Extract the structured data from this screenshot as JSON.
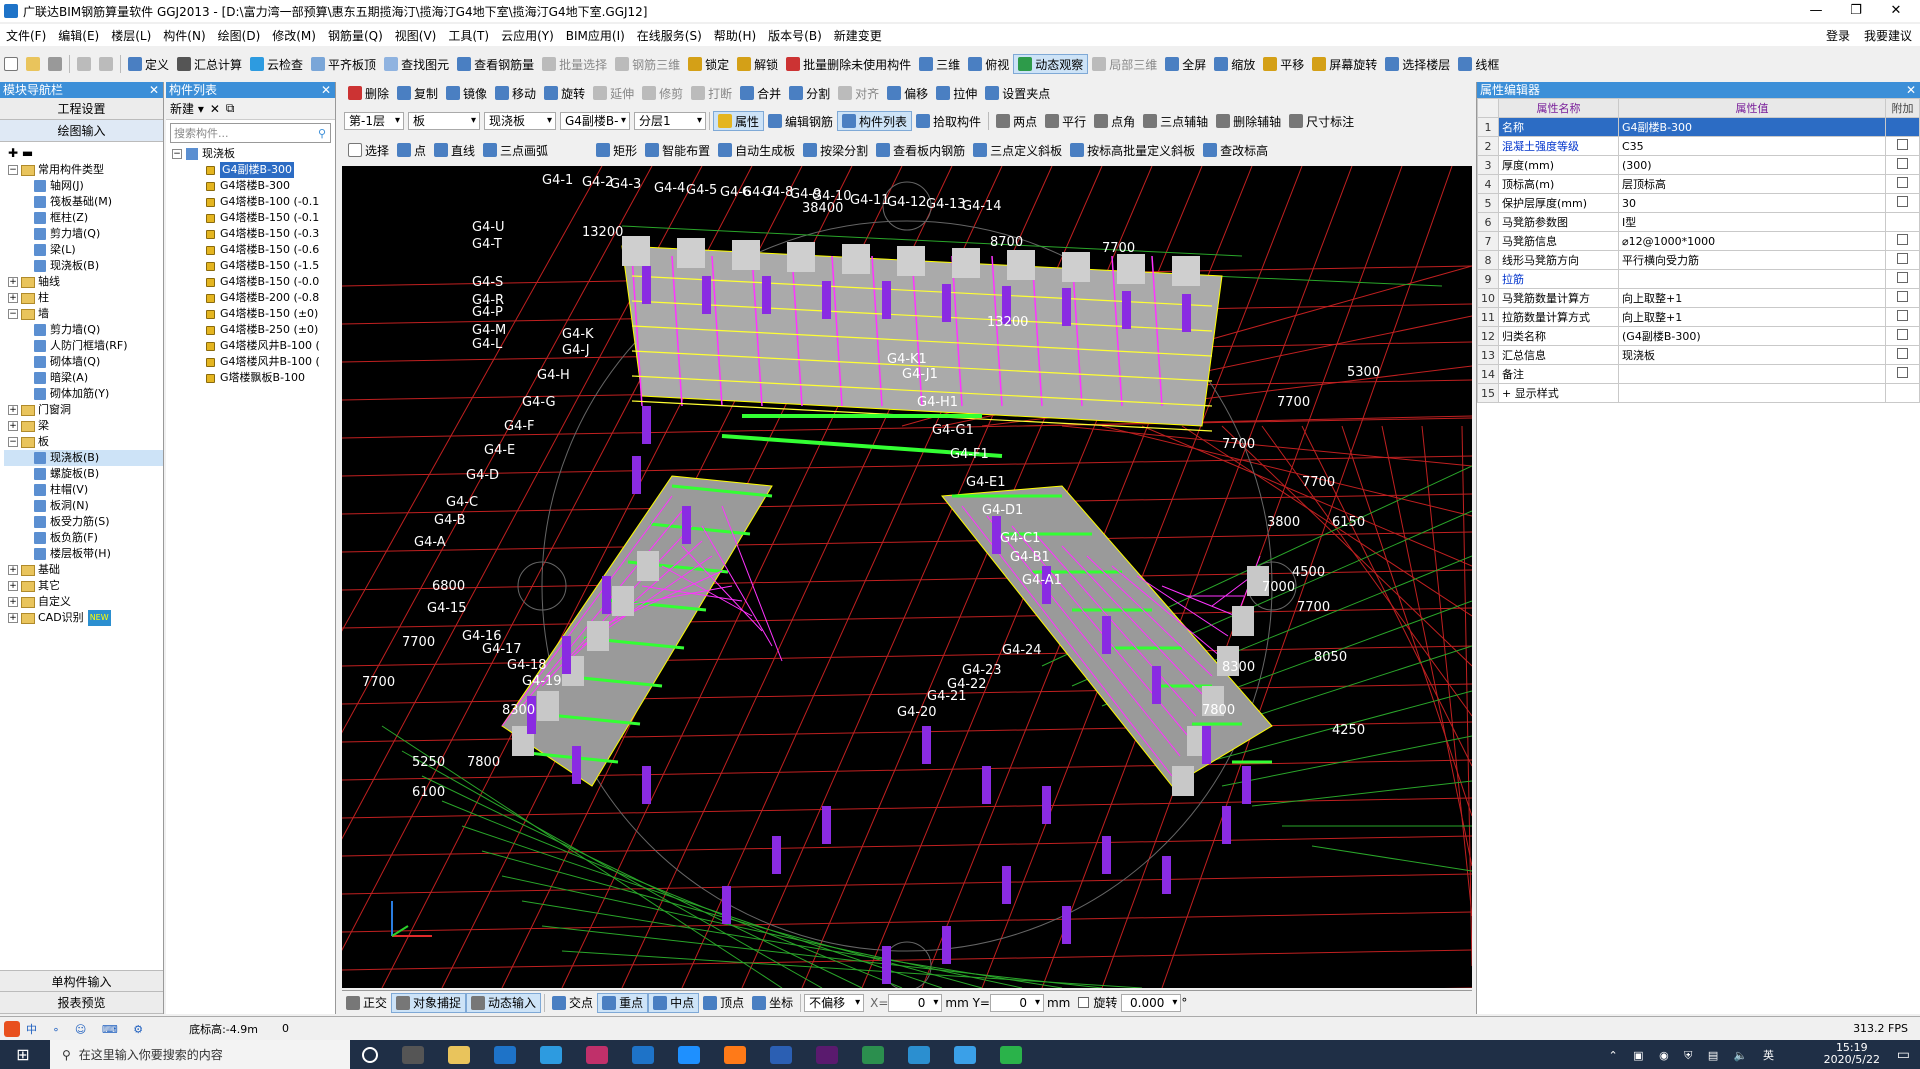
{
  "window": {
    "title": "广联达BIM钢筋算量软件 GGJ2013 - [D:\\富力湾一部预算\\惠东五期揽海汀\\揽海汀G4地下室\\揽海汀G4地下室.GGJ12]",
    "controls": [
      "—",
      "❐",
      "✕"
    ]
  },
  "menu": {
    "items": [
      "文件(F)",
      "编辑(E)",
      "楼层(L)",
      "构件(N)",
      "绘图(D)",
      "修改(M)",
      "钢筋量(Q)",
      "视图(V)",
      "工具(T)",
      "云应用(Y)",
      "BIM应用(I)",
      "在线服务(S)",
      "帮助(H)",
      "版本号(B)",
      "新建变更"
    ],
    "login": "登录",
    "feedback": "我要建议"
  },
  "toolbar1": [
    "定义",
    "汇总计算",
    "云检查",
    "平齐板顶",
    "查找图元",
    "查看钢筋量",
    "批量选择",
    "钢筋三维",
    "锁定",
    "解锁",
    "批量删除未使用构件",
    "三维",
    "俯视",
    "动态观察",
    "局部三维",
    "全屏",
    "缩放",
    "平移",
    "屏幕旋转",
    "选择楼层",
    "线框"
  ],
  "leftnav": {
    "header": "模块导航栏",
    "btn1": "工程设置",
    "btn2": "绘图输入",
    "bottom1": "单构件输入",
    "bottom2": "报表预览",
    "tree": [
      {
        "lvl": 0,
        "exp": "-",
        "label": "常用构件类型",
        "fold": true
      },
      {
        "lvl": 1,
        "label": "轴网(J)"
      },
      {
        "lvl": 1,
        "label": "筏板基础(M)"
      },
      {
        "lvl": 1,
        "label": "框柱(Z)"
      },
      {
        "lvl": 1,
        "label": "剪力墙(Q)"
      },
      {
        "lvl": 1,
        "label": "梁(L)"
      },
      {
        "lvl": 1,
        "label": "现浇板(B)"
      },
      {
        "lvl": 0,
        "exp": "+",
        "label": "轴线",
        "fold": true
      },
      {
        "lvl": 0,
        "exp": "+",
        "label": "柱",
        "fold": true
      },
      {
        "lvl": 0,
        "exp": "-",
        "label": "墙",
        "fold": true
      },
      {
        "lvl": 1,
        "label": "剪力墙(Q)"
      },
      {
        "lvl": 1,
        "label": "人防门框墙(RF)"
      },
      {
        "lvl": 1,
        "label": "砌体墙(Q)"
      },
      {
        "lvl": 1,
        "label": "暗梁(A)"
      },
      {
        "lvl": 1,
        "label": "砌体加筋(Y)"
      },
      {
        "lvl": 0,
        "exp": "+",
        "label": "门窗洞",
        "fold": true
      },
      {
        "lvl": 0,
        "exp": "+",
        "label": "梁",
        "fold": true
      },
      {
        "lvl": 0,
        "exp": "-",
        "label": "板",
        "fold": true
      },
      {
        "lvl": 1,
        "label": "现浇板(B)",
        "sel": true
      },
      {
        "lvl": 1,
        "label": "螺旋板(B)"
      },
      {
        "lvl": 1,
        "label": "柱帽(V)"
      },
      {
        "lvl": 1,
        "label": "板洞(N)"
      },
      {
        "lvl": 1,
        "label": "板受力筋(S)"
      },
      {
        "lvl": 1,
        "label": "板负筋(F)"
      },
      {
        "lvl": 1,
        "label": "楼层板带(H)"
      },
      {
        "lvl": 0,
        "exp": "+",
        "label": "基础",
        "fold": true
      },
      {
        "lvl": 0,
        "exp": "+",
        "label": "其它",
        "fold": true
      },
      {
        "lvl": 0,
        "exp": "+",
        "label": "自定义",
        "fold": true
      },
      {
        "lvl": 0,
        "exp": "+",
        "label": "CAD识别",
        "fold": true,
        "badge": "NEW"
      }
    ]
  },
  "complist": {
    "header": "构件列表",
    "new": "新建",
    "search_placeholder": "搜索构件...",
    "root": "现浇板",
    "items": [
      "G4副楼B-300",
      "G4塔楼B-300",
      "G4塔楼B-100 (-0.1",
      "G4塔楼B-150 (-0.1",
      "G4塔楼B-150 (-0.3",
      "G4塔楼B-150 (-0.6",
      "G4塔楼B-150 (-1.5",
      "G4塔楼B-150 (-0.0",
      "G4塔楼B-200 (-0.8",
      "G4塔楼B-150 (±0)",
      "G4塔楼B-250 (±0)",
      "G4塔楼风井B-100 (",
      "G4塔楼风井B-100 (",
      "G塔楼飘板B-100"
    ]
  },
  "toolbar2": [
    "删除",
    "复制",
    "镜像",
    "移动",
    "旋转",
    "延伸",
    "修剪",
    "打断",
    "合并",
    "分割",
    "对齐",
    "偏移",
    "拉伸",
    "设置夹点"
  ],
  "toolbar3": {
    "floor": "第-1层",
    "type": "板",
    "sub": "现浇板",
    "comp": "G4副楼B-",
    "layer": "分层1",
    "btns": [
      "属性",
      "编辑钢筋",
      "构件列表",
      "拾取构件",
      "两点",
      "平行",
      "点角",
      "三点辅轴",
      "删除辅轴",
      "尺寸标注"
    ]
  },
  "toolbar4": [
    "选择",
    "点",
    "直线",
    "三点画弧",
    "矩形",
    "智能布置",
    "自动生成板",
    "按梁分割",
    "查看板内钢筋",
    "三点定义斜板",
    "按标高批量定义斜板",
    "查改标高"
  ],
  "snapbar": {
    "btns": [
      "正交",
      "对象捕捉",
      "动态输入",
      "交点",
      "重点",
      "中点",
      "顶点",
      "坐标"
    ],
    "offset": "不偏移",
    "x_label": "X=",
    "x_val": "0",
    "y_label": "mm Y=",
    "y_val": "0",
    "unit": "mm",
    "rotate": "旋转",
    "rot_val": "0.000",
    "deg": "°"
  },
  "props": {
    "header": "属性编辑器",
    "cols": [
      "属性名称",
      "属性值",
      "附加"
    ],
    "rows": [
      {
        "n": "1",
        "name": "名称",
        "val": "G4副楼B-300",
        "blue": true,
        "hl": true,
        "cb": false
      },
      {
        "n": "2",
        "name": "混凝土强度等级",
        "val": "C35",
        "blue": true,
        "cb": true
      },
      {
        "n": "3",
        "name": "厚度(mm)",
        "val": "(300)",
        "cb": true
      },
      {
        "n": "4",
        "name": "顶标高(m)",
        "val": "层顶标高",
        "cb": true
      },
      {
        "n": "5",
        "name": "保护层厚度(mm)",
        "val": "30",
        "cb": true
      },
      {
        "n": "6",
        "name": "马凳筋参数图",
        "val": "Ⅰ型",
        "cb": false
      },
      {
        "n": "7",
        "name": "马凳筋信息",
        "val": "⌀12@1000*1000",
        "cb": true
      },
      {
        "n": "8",
        "name": "线形马凳筋方向",
        "val": "平行横向受力筋",
        "cb": true
      },
      {
        "n": "9",
        "name": "拉筋",
        "val": "",
        "blue": true,
        "cb": true
      },
      {
        "n": "10",
        "name": "马凳筋数量计算方",
        "val": "向上取整+1",
        "cb": true
      },
      {
        "n": "11",
        "name": "拉筋数量计算方式",
        "val": "向上取整+1",
        "cb": true
      },
      {
        "n": "12",
        "name": "归类名称",
        "val": "(G4副楼B-300)",
        "cb": true
      },
      {
        "n": "13",
        "name": "汇总信息",
        "val": "现浇板",
        "cb": true
      },
      {
        "n": "14",
        "name": "备注",
        "val": "",
        "cb": true
      },
      {
        "n": "15",
        "name": "+ 显示样式",
        "val": "",
        "cb": false
      }
    ]
  },
  "status": {
    "bottom_elev": "底标高:-4.9m",
    "zero": "0",
    "fps": "313.2 FPS"
  },
  "taskbar": {
    "search": "在这里输入你要搜索的内容",
    "time": "15:19",
    "date": "2020/5/22"
  },
  "canvas": {
    "axis_labels": [
      "G4-1",
      "G4-2",
      "G4-3",
      "G4-4",
      "G4-5",
      "G4-6",
      "G4-7",
      "G4-8",
      "G4-9",
      "G4-10",
      "G4-11",
      "G4-12",
      "G4-13",
      "G4-14",
      "G4-U",
      "G4-T",
      "G4-S",
      "G4-R",
      "G4-P",
      "G4-M",
      "G4-L",
      "G4-K",
      "G4-J",
      "G4-H",
      "G4-G",
      "G4-F",
      "G4-E",
      "G4-D",
      "G4-C",
      "G4-B",
      "G4-A",
      "G4-15",
      "G4-16",
      "G4-17",
      "G4-18",
      "G4-19",
      "G4-K1",
      "G4-J1",
      "G4-H1",
      "G4-G1",
      "G4-F1",
      "G4-E1",
      "G4-D1",
      "G4-C1",
      "G4-B1",
      "G4-A1",
      "G4-24",
      "G4-23",
      "G4-22",
      "G4-21",
      "G4-20"
    ],
    "dims": [
      "8700",
      "7700",
      "7700",
      "7700",
      "5300",
      "7700",
      "6150",
      "3800",
      "4500",
      "7000",
      "7700",
      "8050",
      "8300",
      "7800",
      "4250",
      "6800",
      "7700",
      "7700",
      "8300",
      "7800",
      "5250",
      "6100",
      "38400",
      "13200",
      "13200"
    ]
  }
}
